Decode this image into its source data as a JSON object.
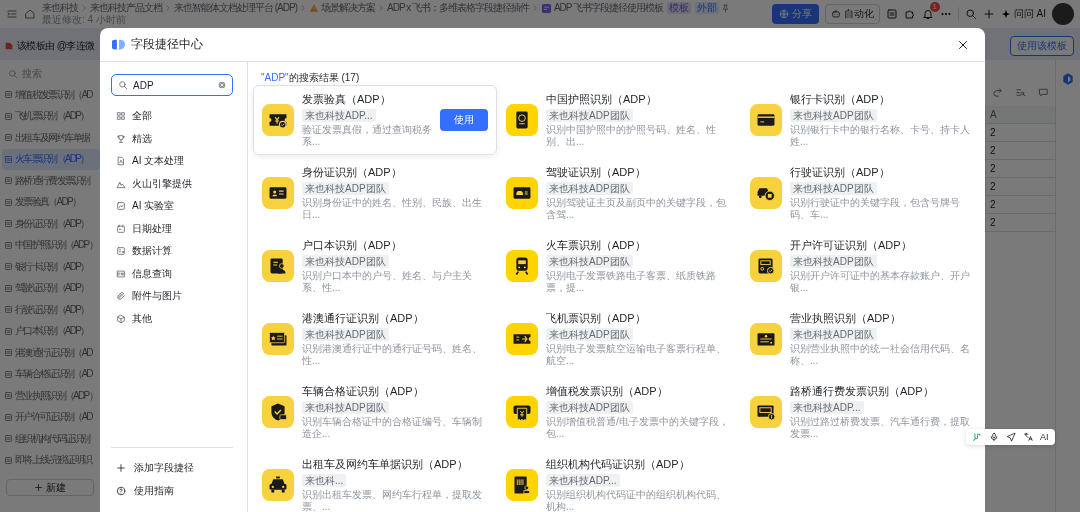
{
  "top_bar": {
    "breadcrumbs": [
      {
        "label": "来也科技",
        "kind": "plain"
      },
      {
        "label": "来也科技产品文档",
        "kind": "plain"
      },
      {
        "label": "来也智能体文档处理平台 (ADP)",
        "kind": "plain"
      },
      {
        "label": "场景解决方案",
        "kind": "warning"
      },
      {
        "label": "ADP x 飞书：多维表格字段捷径插件",
        "kind": "plain"
      },
      {
        "label": "ADP 飞书字段捷径使用模板",
        "kind": "doc",
        "tags": [
          "模板",
          "外部"
        ]
      }
    ],
    "subtitle": "最近修改: 4 小时前",
    "share_button": "分享",
    "automation_button": "自动化",
    "notification_count": "1",
    "ask_ai": "问问 AI"
  },
  "banner": {
    "text": "该模板由 @李连微",
    "use_template_button": "使用该模板"
  },
  "doc_list": {
    "search_placeholder": "搜索",
    "items": [
      {
        "label": "增值税发票识别（AD",
        "selected": false
      },
      {
        "label": "飞机票识别（ADP）",
        "selected": false
      },
      {
        "label": "出租车及网约车单据",
        "selected": false
      },
      {
        "label": "火车票识别（ADP）",
        "selected": true
      },
      {
        "label": "路桥通行费发票识别",
        "selected": false
      },
      {
        "label": "发票验真（ADP）",
        "selected": false
      },
      {
        "label": "身份证识别（ADP）",
        "selected": false
      },
      {
        "label": "中国护照识别（ADP）",
        "selected": false
      },
      {
        "label": "银行卡识别（ADP）",
        "selected": false
      },
      {
        "label": "驾驶证识别（ADP）",
        "selected": false
      },
      {
        "label": "行驶证识别（ADP）",
        "selected": false
      },
      {
        "label": "户口本识别（ADP）",
        "selected": false
      },
      {
        "label": "港澳通行证识别（AD",
        "selected": false
      },
      {
        "label": "车辆合格证识别（AD",
        "selected": false
      },
      {
        "label": "营业执照识别（ADP）",
        "selected": false
      },
      {
        "label": "开户许可证识别（AD",
        "selected": false
      },
      {
        "label": "组织机构代码证识别",
        "selected": false
      },
      {
        "label": "即将上线-完税证明识",
        "selected": false
      }
    ],
    "new_button": "新建"
  },
  "table": {
    "column_header": "A",
    "cells": [
      "2",
      "2",
      "2",
      "2",
      "2",
      "2"
    ]
  },
  "floating_toolbar": {
    "label": "AI"
  },
  "modal": {
    "title": "字段捷径中心",
    "search": {
      "value": "ADP"
    },
    "categories": [
      {
        "label": "全部"
      },
      {
        "label": "精选"
      },
      {
        "label": "AI 文本处理"
      },
      {
        "label": "火山引擎提供"
      },
      {
        "label": "AI 实验室"
      },
      {
        "label": "日期处理"
      },
      {
        "label": "数据计算"
      },
      {
        "label": "信息查询"
      },
      {
        "label": "附件与图片"
      },
      {
        "label": "其他"
      }
    ],
    "footer_links": [
      "添加字段捷径",
      "使用指南"
    ],
    "results_heading": {
      "query": "\"ADP\"",
      "label": "的搜索结果 (17)"
    },
    "use_button": "使用",
    "results": [
      {
        "title": "发票验真（ADP）",
        "tag": "来也科技ADP...",
        "description": "验证发票真假，通过查询税务系...",
        "hovered": true
      },
      {
        "title": "中国护照识别（ADP）",
        "tag": "来也科技ADP团队",
        "description": "识别中国护照中的护照号码、姓名、性别、出...",
        "hovered": false
      },
      {
        "title": "银行卡识别（ADP）",
        "tag": "来也科技ADP团队",
        "description": "识别银行卡中的银行名称、卡号、持卡人姓...",
        "hovered": false
      },
      {
        "title": "身份证识别（ADP）",
        "tag": "来也科技ADP团队",
        "description": "识别身份证中的姓名、性别、民族、出生日...",
        "hovered": false
      },
      {
        "title": "驾驶证识别（ADP）",
        "tag": "来也科技ADP团队",
        "description": "识别驾驶证主页及副页中的关键字段，包含驾...",
        "hovered": false
      },
      {
        "title": "行驶证识别（ADP）",
        "tag": "来也科技ADP团队",
        "description": "识别行驶证中的关键字段，包含号牌号码、车...",
        "hovered": false
      },
      {
        "title": "户口本识别（ADP）",
        "tag": "来也科技ADP团队",
        "description": "识别户口本中的户号、姓名、与户主关系、性...",
        "hovered": false
      },
      {
        "title": "火车票识别（ADP）",
        "tag": "来也科技ADP团队",
        "description": "识别电子发票铁路电子客票、纸质铁路票，提...",
        "hovered": false
      },
      {
        "title": "开户许可证识别（ADP）",
        "tag": "来也科技ADP团队",
        "description": "识别开户许可证中的基本存款账户、开户银...",
        "hovered": false
      },
      {
        "title": "港澳通行证识别（ADP）",
        "tag": "来也科技ADP团队",
        "description": "识别港澳通行证中的通行证号码、姓名、性...",
        "hovered": false
      },
      {
        "title": "飞机票识别（ADP）",
        "tag": "来也科技ADP团队",
        "description": "识别电子发票航空运输电子客票行程单、航空...",
        "hovered": false
      },
      {
        "title": "营业执照识别（ADP）",
        "tag": "来也科技ADP团队",
        "description": "识别营业执照中的统一社会信用代码、名称、...",
        "hovered": false
      },
      {
        "title": "车辆合格证识别（ADP）",
        "tag": "来也科技ADP团队",
        "description": "识别车辆合格证中的合格证编号、车辆制造企...",
        "hovered": false
      },
      {
        "title": "增值税发票识别（ADP）",
        "tag": "来也科技ADP团队",
        "description": "识别增值税普通/电子发票中的关键字段，包...",
        "hovered": false
      },
      {
        "title": "路桥通行费发票识别（ADP）",
        "tag": "来也科技ADP...",
        "description": "识别过路过桥费发票、汽车通行费，提取发票...",
        "hovered": false
      },
      {
        "title": "出租车及网约车单据识别（ADP）",
        "tag": "来也科...",
        "description": "识别出租车发票、网约车行程单，提取发票、...",
        "hovered": false
      },
      {
        "title": "组织机构代码证识别（ADP）",
        "tag": "来也科技ADP...",
        "description": "识别组织机构代码证中的组织机构代码、机构...",
        "hovered": false
      }
    ]
  }
}
